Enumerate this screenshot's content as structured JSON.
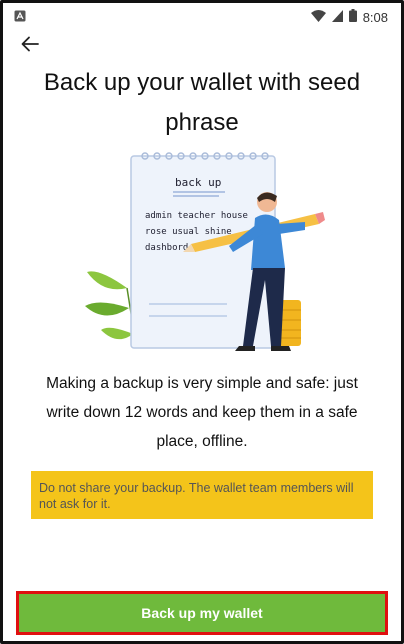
{
  "status_bar": {
    "time": "8:08",
    "icons": [
      "app-notification-icon",
      "wifi-icon",
      "signal-icon",
      "battery-icon"
    ]
  },
  "header": {
    "back_icon": "arrow-left-icon"
  },
  "title": "Back up your wallet with seed phrase",
  "illustration": {
    "heading": "back up",
    "line1": "admin teacher house",
    "line2": "rose usual shine",
    "line3": "dashbord"
  },
  "description": "Making a backup is very simple and safe: just write down 12 words and keep them in a safe place, offline.",
  "warning": {
    "text": "Do not share your backup. The wallet team members will not ask for it.",
    "color": "#f4c41a"
  },
  "cta": {
    "label": "Back up my wallet",
    "color": "#6fba3c",
    "highlight_color": "#e01010"
  }
}
